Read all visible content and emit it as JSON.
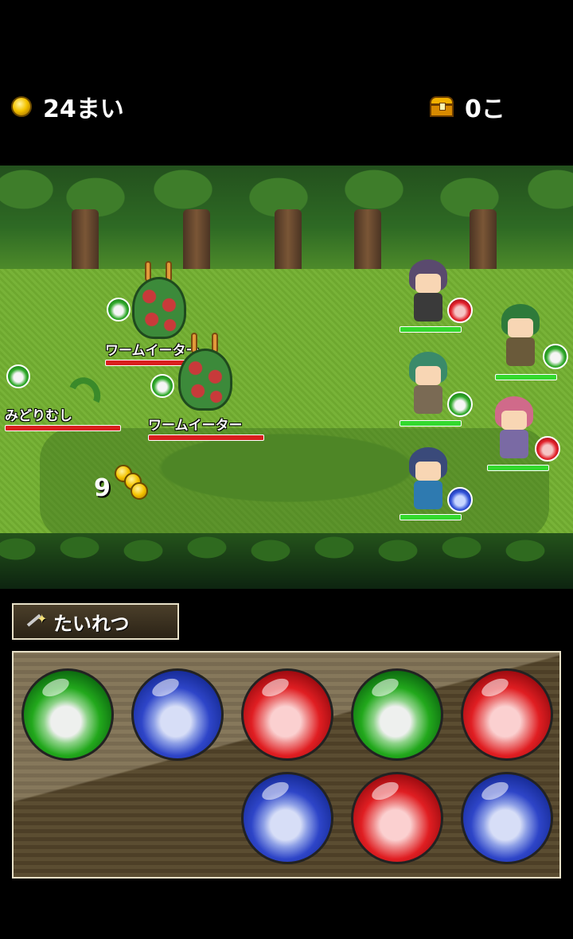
{
  "hud": {
    "coins": "24まい",
    "treasure": "0こ"
  },
  "battle": {
    "enemies": [
      {
        "name": "ワームイーター",
        "element": "green"
      },
      {
        "name": "ワームイーター",
        "element": "green"
      },
      {
        "name": "みどりむし",
        "element": "green"
      }
    ],
    "party": [
      {
        "name": "purple-hair-warrior",
        "element": "red"
      },
      {
        "name": "green-hair-bandana",
        "element": "green"
      },
      {
        "name": "green-hair-girl",
        "element": "green"
      },
      {
        "name": "pink-hair-girl",
        "element": "red"
      },
      {
        "name": "blue-hair-girl",
        "element": "blue"
      }
    ],
    "coin_drop_text": "9",
    "enemy_hp_color": "#d91e1e",
    "party_hp_color": "#33d92e"
  },
  "command": {
    "tab_label": "たいれつ",
    "tab_icon": "magic-wand-icon"
  },
  "board": {
    "orbs_row1": [
      "green",
      "blue",
      "red",
      "green",
      "red"
    ],
    "orbs_row2": [
      "blue",
      "red",
      "blue"
    ]
  }
}
